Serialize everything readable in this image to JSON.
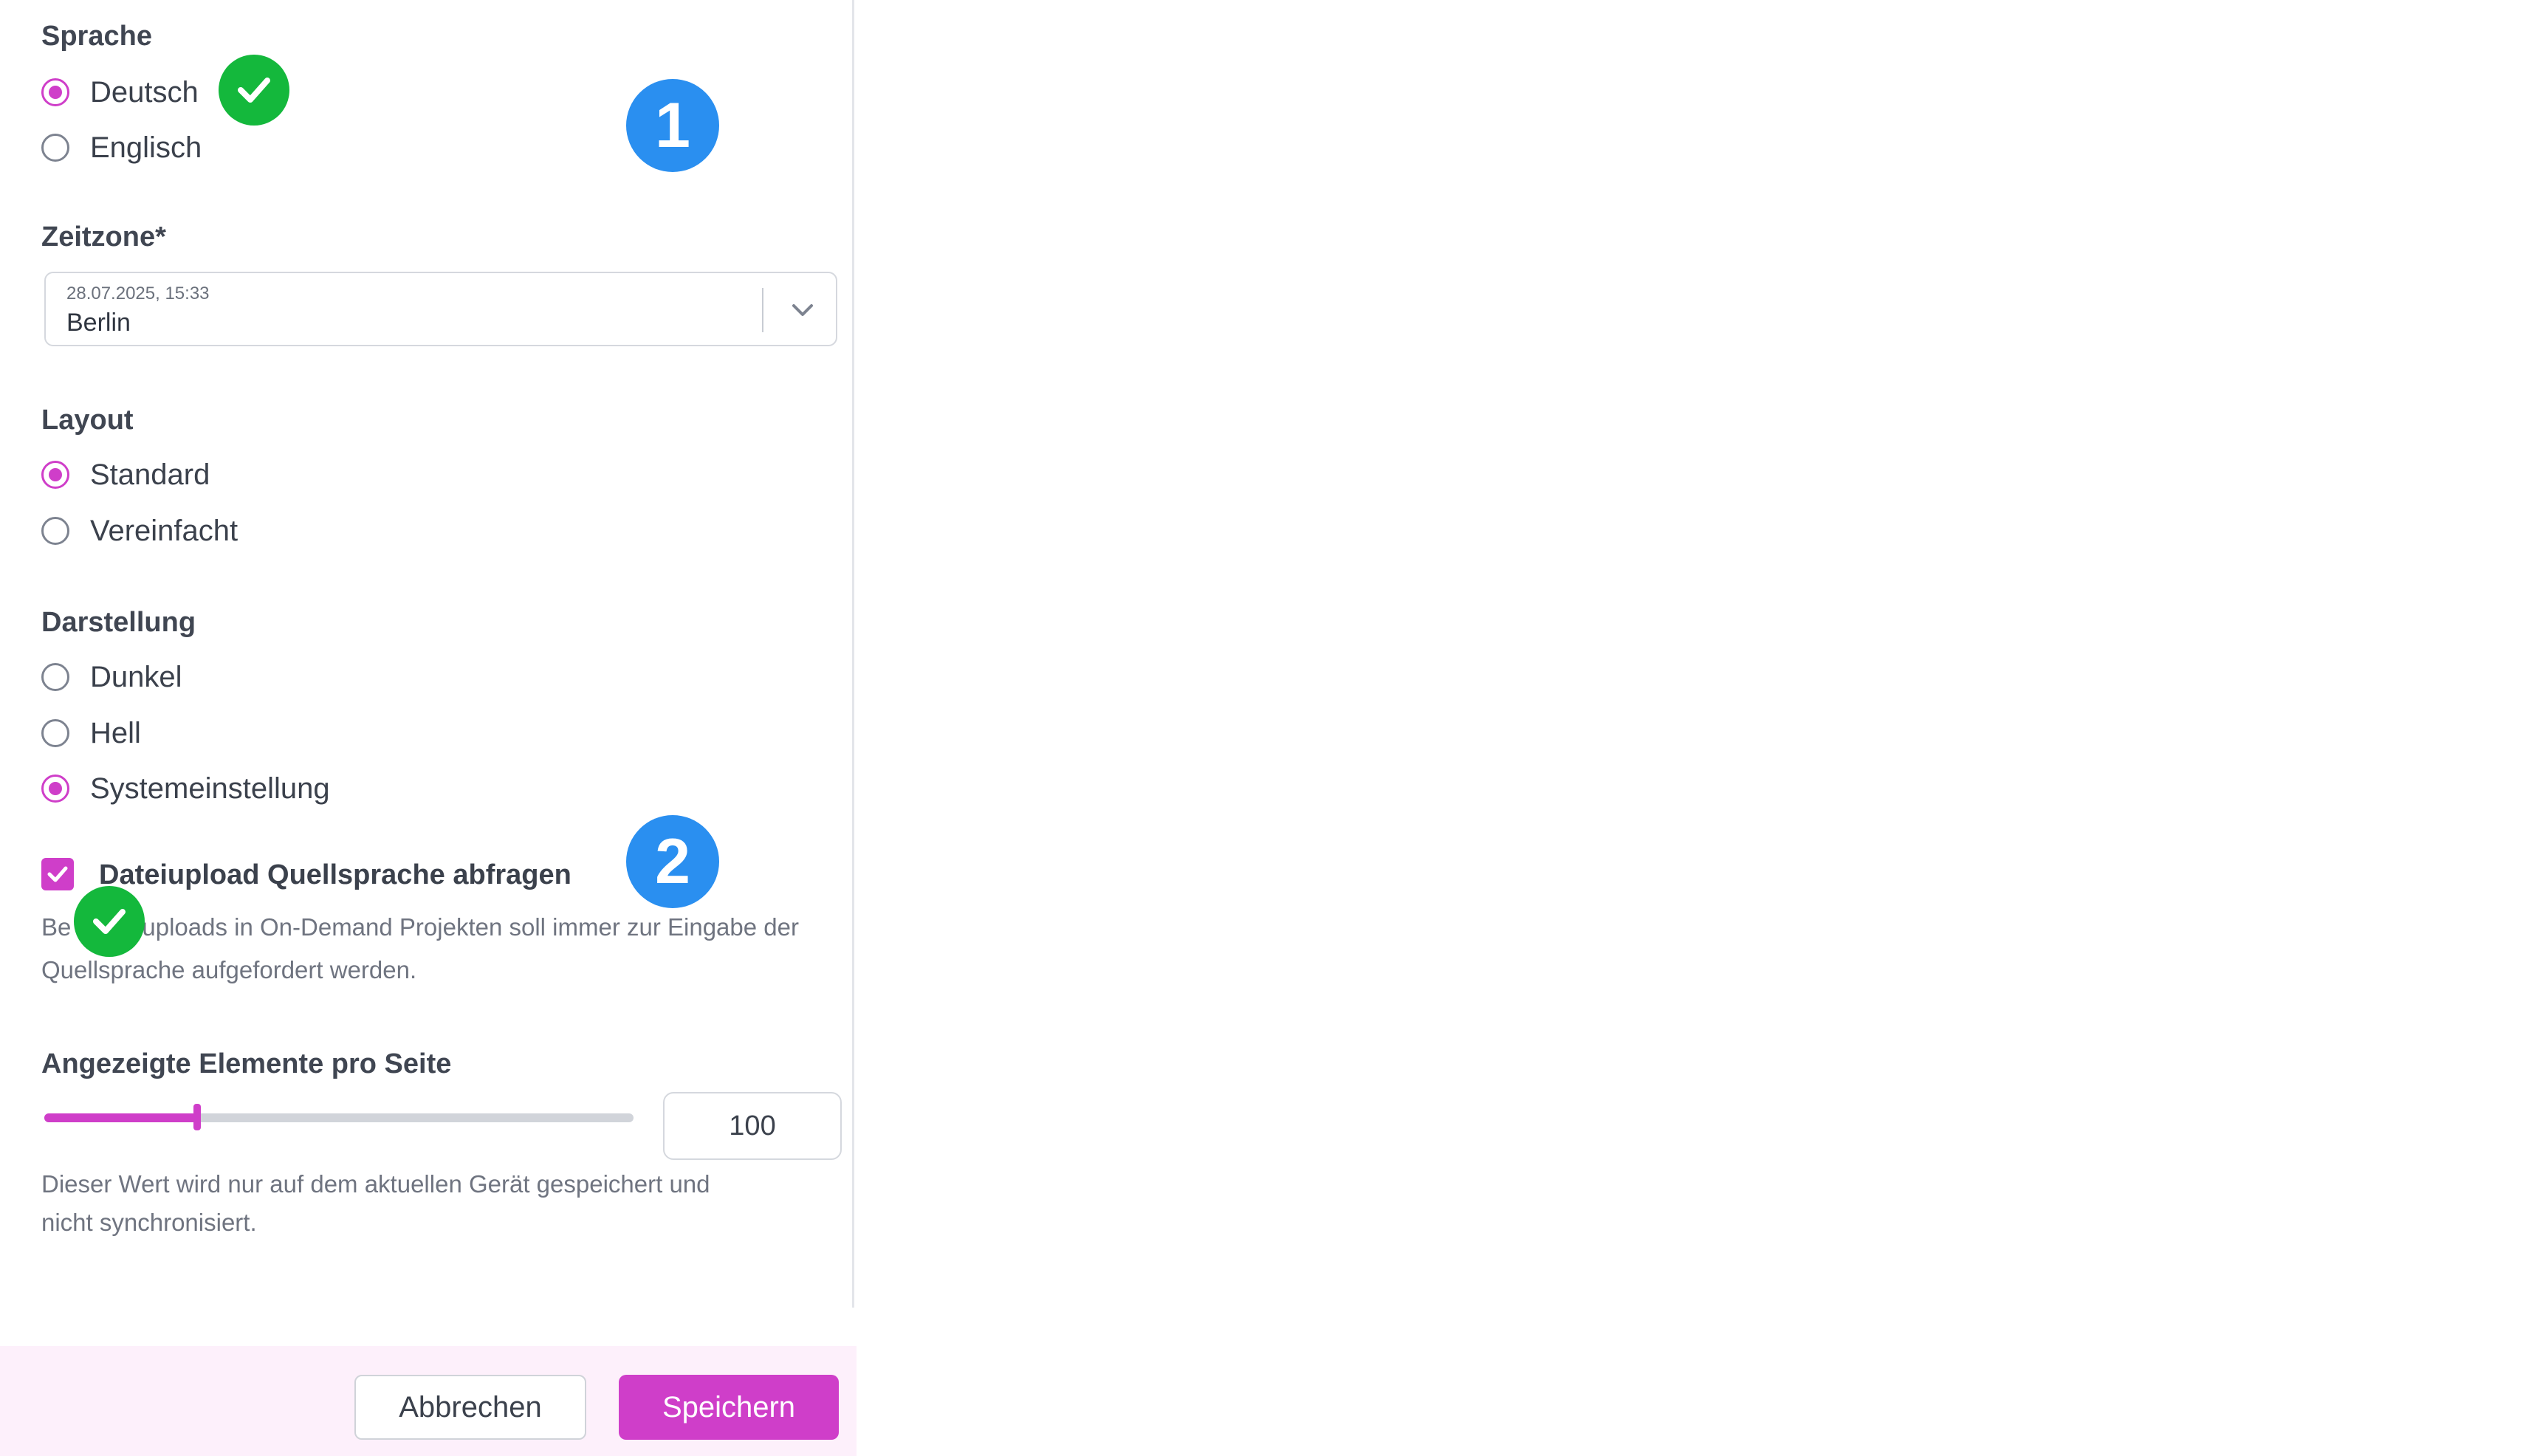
{
  "language": {
    "heading": "Sprache",
    "options": [
      {
        "label": "Deutsch",
        "checked": true
      },
      {
        "label": "Englisch",
        "checked": false
      }
    ]
  },
  "timezone": {
    "heading": "Zeitzone*",
    "datetime": "28.07.2025, 15:33",
    "value": "Berlin"
  },
  "layout": {
    "heading": "Layout",
    "options": [
      {
        "label": "Standard",
        "checked": true
      },
      {
        "label": "Vereinfacht",
        "checked": false
      }
    ]
  },
  "appearance": {
    "heading": "Darstellung",
    "options": [
      {
        "label": "Dunkel",
        "checked": false
      },
      {
        "label": "Hell",
        "checked": false
      },
      {
        "label": "Systemeinstellung",
        "checked": true
      }
    ]
  },
  "upload": {
    "checkbox_label": "Dateiupload Quellsprache abfragen",
    "checked": true,
    "help_line1_start": "Be",
    "help_line1_end": "uploads in On-Demand Projekten soll immer zur Eingabe der",
    "help_line2": "Quellsprache aufgefordert werden."
  },
  "items_per_page": {
    "heading": "Angezeigte Elemente pro Seite",
    "value": "100",
    "slider_fraction": 0.26,
    "help_line1": "Dieser Wert wird nur auf dem aktuellen Gerät gespeichert und",
    "help_line2": "nicht synchronisiert."
  },
  "footer": {
    "cancel_label": "Abbrechen",
    "save_label": "Speichern"
  },
  "annotations": {
    "badge_1": "1",
    "badge_2": "2",
    "checkmark_icon": "check-icon"
  },
  "colors": {
    "accent": "#cf3ec9",
    "badge_blue": "#2a8ff0",
    "badge_green": "#14b83c",
    "footer_bg": "#fdf0fb"
  }
}
